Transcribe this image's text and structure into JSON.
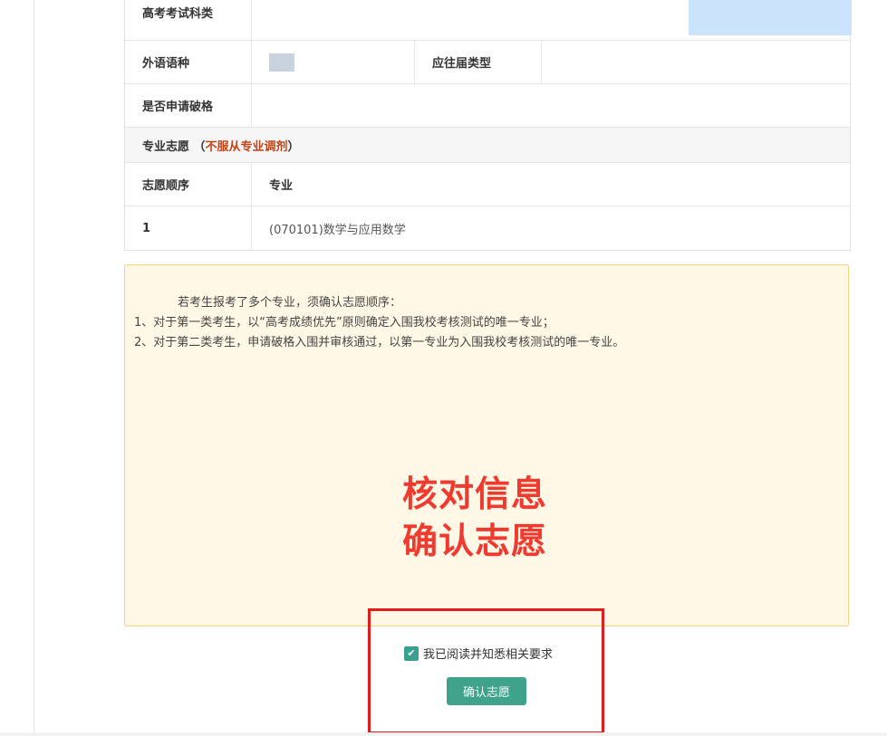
{
  "table": {
    "exam_category_label": "高考考试科类",
    "foreign_language_label": "外语语种",
    "graduate_type_label": "应往届类型",
    "exceptional_label": "是否申请破格",
    "major_pref_prefix": "专业志愿 （",
    "major_pref_accent": "不服从专业调剂",
    "major_pref_suffix": " ）",
    "order_header": "志愿顺序",
    "major_header": "专业",
    "rows": [
      {
        "order": "1",
        "major": "(070101)数学与应用数学"
      }
    ]
  },
  "notice": {
    "intro": "若考生报考了多个专业，须确认志愿顺序：",
    "line1": "1、对于第一类考生，以“高考成绩优先”原则确定入围我校考核测试的唯一专业；",
    "line2": "2、对于第二类考生，申请破格入围并审核通过，以第一专业为入围我校考核测试的唯一专业。"
  },
  "annotation": {
    "line1": "核对信息",
    "line2": "确认志愿",
    "color": "#f03a2f"
  },
  "agree": {
    "label": "我已阅读并知悉相关要求",
    "checked": true
  },
  "confirm_button": "确认志愿",
  "colors": {
    "accent": "#c14316",
    "button": "#3fa28b",
    "notice_bg": "#fff8e6",
    "highlight": "#e21b1b"
  }
}
